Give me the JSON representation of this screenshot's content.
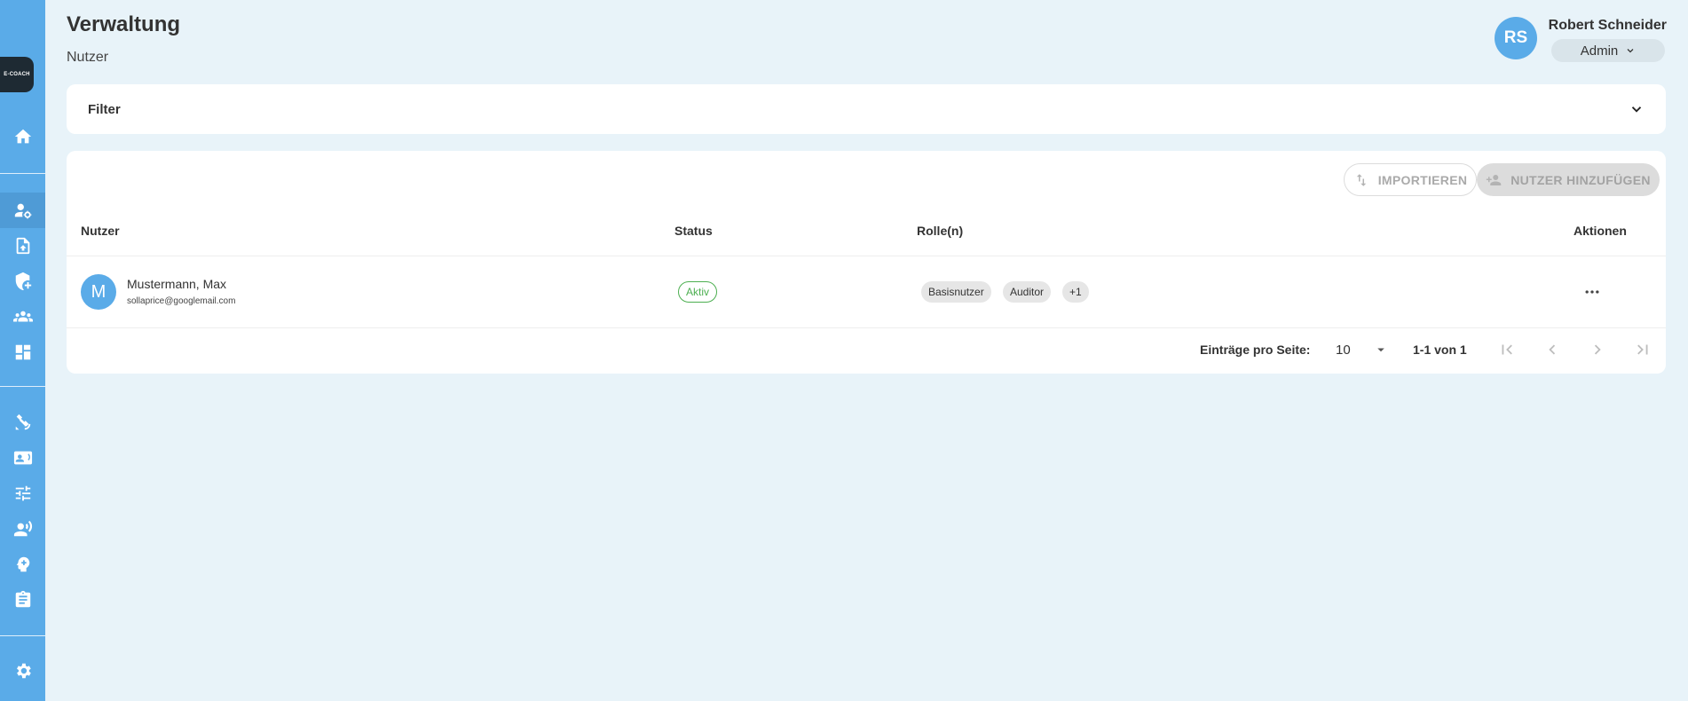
{
  "sidebar": {
    "logo_text": "E-COACH",
    "items": [
      {
        "icon": "home-icon"
      },
      {
        "icon": "user-settings-icon",
        "active": true
      },
      {
        "icon": "file-upload-icon"
      },
      {
        "icon": "shield-add-icon"
      },
      {
        "icon": "groups-icon"
      },
      {
        "icon": "dashboard-icon"
      },
      {
        "icon": "satellite-icon"
      },
      {
        "icon": "contact-card-icon"
      },
      {
        "icon": "sliders-icon"
      },
      {
        "icon": "voice-user-icon"
      },
      {
        "icon": "brain-icon"
      },
      {
        "icon": "clipboard-icon"
      },
      {
        "icon": "gear-icon"
      }
    ]
  },
  "header": {
    "title": "Verwaltung",
    "subtitle": "Nutzer"
  },
  "user": {
    "initials": "RS",
    "name": "Robert Schneider",
    "role": "Admin"
  },
  "filter": {
    "label": "Filter"
  },
  "toolbar": {
    "import_label": "IMPORTIEREN",
    "add_user_label": "NUTZER HINZUFÜGEN"
  },
  "table": {
    "headers": {
      "user": "Nutzer",
      "status": "Status",
      "roles": "Rolle(n)",
      "actions": "Aktionen"
    },
    "rows": [
      {
        "initial": "M",
        "name": "Mustermann, Max",
        "email": "sollaprice@googlemail.com",
        "status": "Aktiv",
        "roles": [
          "Basisnutzer",
          "Auditor",
          "+1"
        ]
      }
    ]
  },
  "pagination": {
    "per_page_label": "Einträge pro Seite:",
    "per_page_value": "10",
    "range": "1-1 von 1"
  },
  "colors": {
    "accent": "#5aabe8",
    "background": "#e8f3f9",
    "status_active": "#4caf50"
  }
}
